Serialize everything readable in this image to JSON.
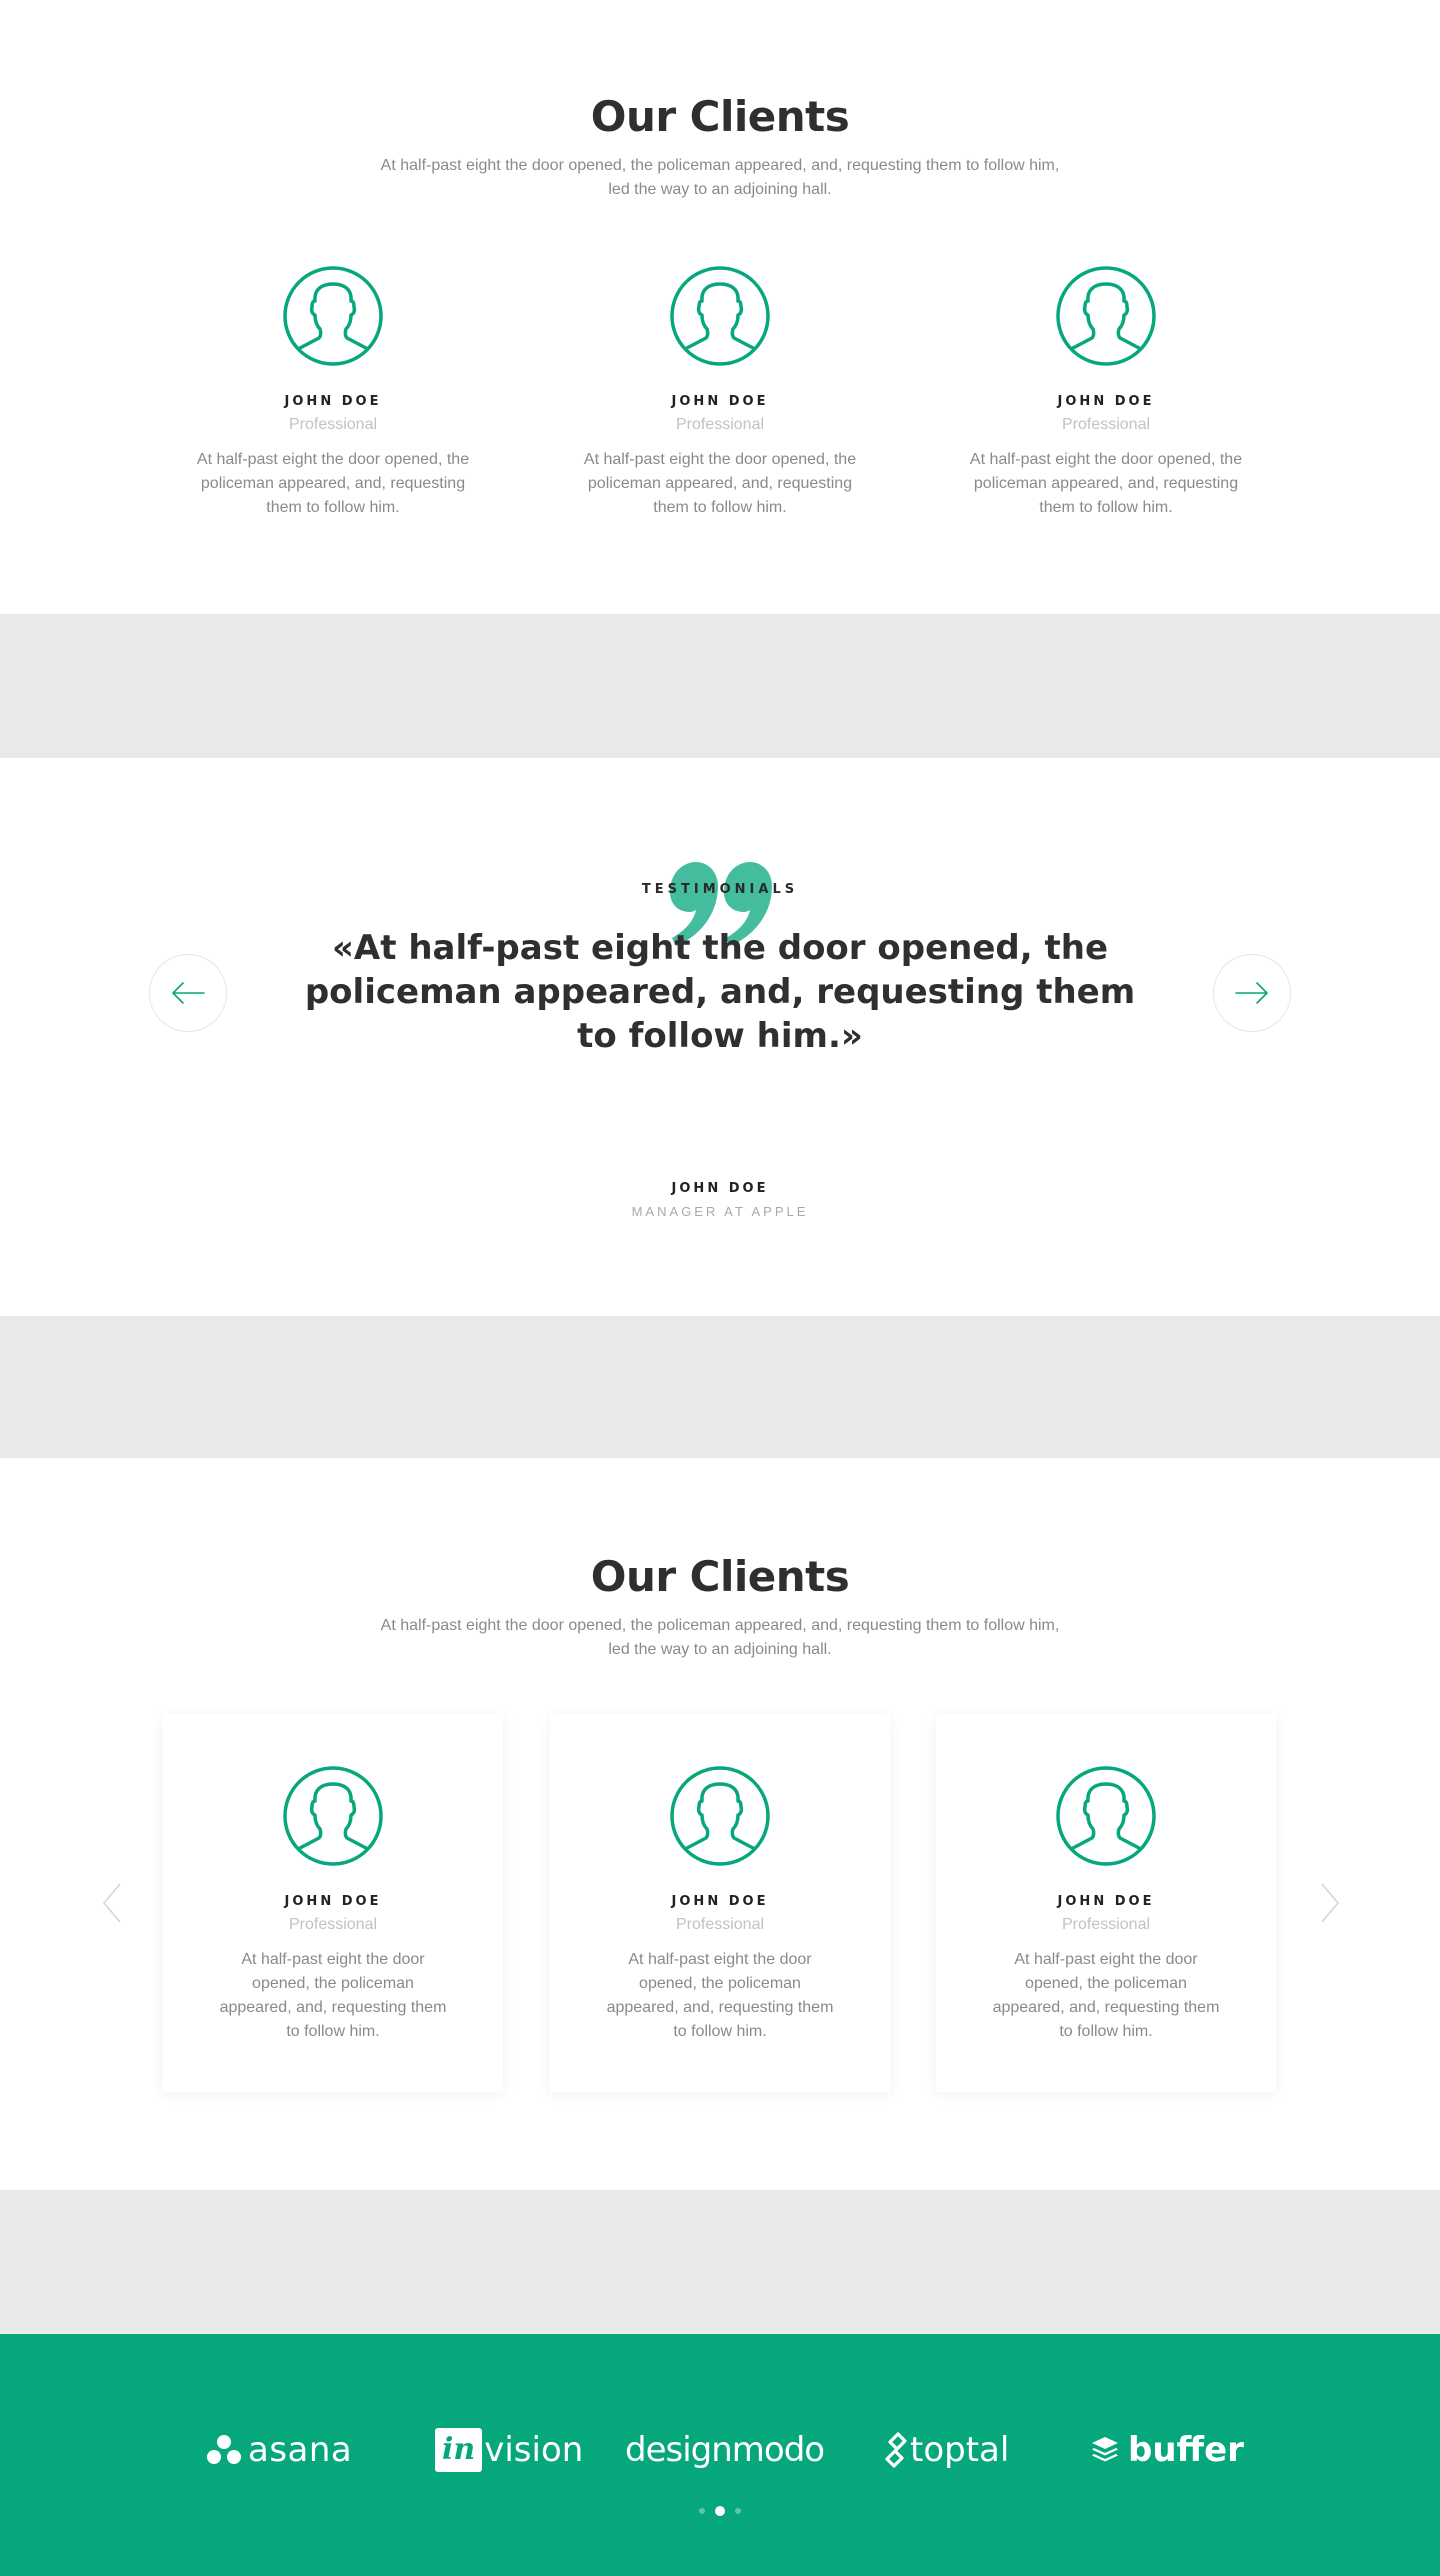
{
  "clients_section_1": {
    "title": "Our Clients",
    "subtitle": "At half-past eight the door opened, the policeman appeared, and, requesting them to follow him, led the way to an adjoining hall.",
    "clients": [
      {
        "name": "JOHN DOE",
        "role": "Professional",
        "description": "At half-past eight the door opened, the policeman appeared, and, requesting them to follow him."
      },
      {
        "name": "JOHN DOE",
        "role": "Professional",
        "description": "At half-past eight the door opened, the policeman appeared, and, requesting them to follow him."
      },
      {
        "name": "JOHN DOE",
        "role": "Professional",
        "description": "At half-past eight the door opened, the policeman appeared, and, requesting them to follow him."
      }
    ]
  },
  "testimonials": {
    "label": "TESTIMONIALS",
    "quote": "«At half-past eight the door opened, the policeman appeared, and, requesting them to follow him.»",
    "author": "JOHN DOE",
    "author_role": "MANAGER AT APPLE",
    "prev_icon": "arrow-left-icon",
    "next_icon": "arrow-right-icon"
  },
  "clients_section_2": {
    "title": "Our Clients",
    "subtitle": "At half-past eight the door opened, the policeman appeared, and, requesting them to follow him, led the way to an adjoining hall.",
    "clients": [
      {
        "name": "JOHN DOE",
        "role": "Professional",
        "description": "At half-past eight the door opened, the policeman appeared, and, requesting them to follow him."
      },
      {
        "name": "JOHN DOE",
        "role": "Professional",
        "description": "At half-past eight the door opened, the policeman appeared, and, requesting them to follow him."
      },
      {
        "name": "JOHN DOE",
        "role": "Professional",
        "description": "At half-past eight the door opened, the policeman appeared, and, requesting them to follow him."
      }
    ],
    "prev_icon": "chevron-left-icon",
    "next_icon": "chevron-right-icon"
  },
  "logos_footer": {
    "logos": [
      "asana",
      "vision",
      "designmodo",
      "toptal",
      "buffer"
    ],
    "invision_mark": "in",
    "active_slide": 2,
    "slide_count": 3
  },
  "colors": {
    "accent": "#06a77d",
    "gap_band": "#e9e9e9",
    "title": "#2f2f2f",
    "body_text": "#8a8a8a",
    "muted": "#c2c2c2"
  }
}
